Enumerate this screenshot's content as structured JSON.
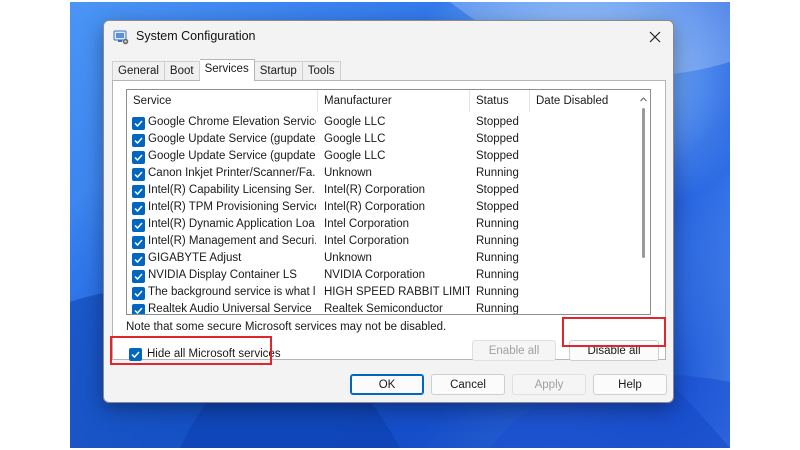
{
  "window": {
    "title": "System Configuration",
    "close_icon": "close-icon",
    "app_icon": "msconfig-icon"
  },
  "tabs": [
    {
      "label": "General",
      "active": false
    },
    {
      "label": "Boot",
      "active": false
    },
    {
      "label": "Services",
      "active": true
    },
    {
      "label": "Startup",
      "active": false
    },
    {
      "label": "Tools",
      "active": false
    }
  ],
  "services_table": {
    "columns": [
      "Service",
      "Manufacturer",
      "Status",
      "Date Disabled"
    ],
    "rows": [
      {
        "checked": true,
        "service": "Google Chrome Elevation Service...",
        "manufacturer": "Google LLC",
        "status": "Stopped",
        "date_disabled": ""
      },
      {
        "checked": true,
        "service": "Google Update Service (gupdate)",
        "manufacturer": "Google LLC",
        "status": "Stopped",
        "date_disabled": ""
      },
      {
        "checked": true,
        "service": "Google Update Service (gupdatem)",
        "manufacturer": "Google LLC",
        "status": "Stopped",
        "date_disabled": ""
      },
      {
        "checked": true,
        "service": "Canon Inkjet Printer/Scanner/Fa...",
        "manufacturer": "Unknown",
        "status": "Running",
        "date_disabled": ""
      },
      {
        "checked": true,
        "service": "Intel(R) Capability Licensing Ser...",
        "manufacturer": "Intel(R) Corporation",
        "status": "Stopped",
        "date_disabled": ""
      },
      {
        "checked": true,
        "service": "Intel(R) TPM Provisioning Service",
        "manufacturer": "Intel(R) Corporation",
        "status": "Stopped",
        "date_disabled": ""
      },
      {
        "checked": true,
        "service": "Intel(R) Dynamic Application Loa...",
        "manufacturer": "Intel Corporation",
        "status": "Running",
        "date_disabled": ""
      },
      {
        "checked": true,
        "service": "Intel(R) Management and Securi...",
        "manufacturer": "Intel Corporation",
        "status": "Running",
        "date_disabled": ""
      },
      {
        "checked": true,
        "service": "GIGABYTE Adjust",
        "manufacturer": "Unknown",
        "status": "Running",
        "date_disabled": ""
      },
      {
        "checked": true,
        "service": "NVIDIA Display Container LS",
        "manufacturer": "NVIDIA Corporation",
        "status": "Running",
        "date_disabled": ""
      },
      {
        "checked": true,
        "service": "The background service is what l...",
        "manufacturer": "HIGH SPEED RABBIT LIMIT...",
        "status": "Running",
        "date_disabled": ""
      },
      {
        "checked": true,
        "service": "Realtek Audio Universal Service",
        "manufacturer": "Realtek Semiconductor",
        "status": "Running",
        "date_disabled": ""
      }
    ]
  },
  "note": "Note that some secure Microsoft services may not be disabled.",
  "enable_all": {
    "label": "Enable all",
    "disabled": true
  },
  "disable_all": {
    "label": "Disable all",
    "disabled": false
  },
  "hide_ms": {
    "label": "Hide all Microsoft services",
    "checked": true
  },
  "footer": {
    "ok": "OK",
    "cancel": "Cancel",
    "apply": "Apply",
    "help": "Help"
  },
  "colors": {
    "accent": "#0067c0",
    "highlight": "#e0262c"
  }
}
